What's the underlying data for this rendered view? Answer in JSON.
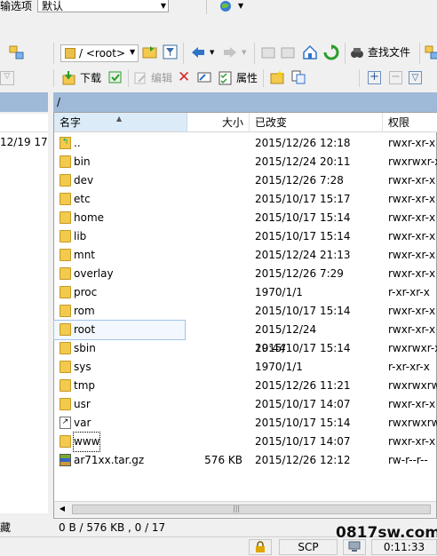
{
  "top": {
    "transfer_label": "传输选项",
    "transfer_value": "默认"
  },
  "toolbar": {
    "path_value": "/ <root>",
    "find_files": "查找文件"
  },
  "toolbar2": {
    "download": "下载",
    "edit": "编辑",
    "properties": "属性"
  },
  "left_panel": {
    "row_text": "12/19  17"
  },
  "path_bar": "/",
  "columns": {
    "name": "名字",
    "size": "大小",
    "date": "已改变",
    "perm": "权限"
  },
  "rows": [
    {
      "name": "..",
      "size": "",
      "date": "2015/12/26 12:18",
      "perm": "rwxr-xr-x",
      "icon": "parent-dir-icon"
    },
    {
      "name": "bin",
      "size": "",
      "date": "2015/12/24 20:11",
      "perm": "rwxrwxr-x",
      "icon": "folder-icon"
    },
    {
      "name": "dev",
      "size": "",
      "date": "2015/12/26 7:28",
      "perm": "rwxr-xr-x",
      "icon": "folder-icon"
    },
    {
      "name": "etc",
      "size": "",
      "date": "2015/10/17 15:17",
      "perm": "rwxr-xr-x",
      "icon": "folder-icon"
    },
    {
      "name": "home",
      "size": "",
      "date": "2015/10/17 15:14",
      "perm": "rwxr-xr-x",
      "icon": "folder-icon"
    },
    {
      "name": "lib",
      "size": "",
      "date": "2015/10/17 15:14",
      "perm": "rwxr-xr-x",
      "icon": "folder-icon"
    },
    {
      "name": "mnt",
      "size": "",
      "date": "2015/12/24 21:13",
      "perm": "rwxr-xr-x",
      "icon": "folder-icon"
    },
    {
      "name": "overlay",
      "size": "",
      "date": "2015/12/26 7:29",
      "perm": "rwxr-xr-x",
      "icon": "folder-icon"
    },
    {
      "name": "proc",
      "size": "",
      "date": "1970/1/1",
      "perm": "r-xr-xr-x",
      "icon": "folder-icon"
    },
    {
      "name": "rom",
      "size": "",
      "date": "2015/10/17 15:14",
      "perm": "rwxr-xr-x",
      "icon": "folder-icon"
    },
    {
      "name": "root",
      "size": "",
      "date": "2015/12/24 19:44",
      "perm": "rwxr-xr-x",
      "icon": "folder-icon"
    },
    {
      "name": "sbin",
      "size": "",
      "date": "2015/10/17 15:14",
      "perm": "rwxrwxr-x",
      "icon": "folder-icon"
    },
    {
      "name": "sys",
      "size": "",
      "date": "1970/1/1",
      "perm": "r-xr-xr-x",
      "icon": "folder-icon"
    },
    {
      "name": "tmp",
      "size": "",
      "date": "2015/12/26 11:21",
      "perm": "rwxrwxrw",
      "icon": "folder-icon"
    },
    {
      "name": "usr",
      "size": "",
      "date": "2015/10/17 14:07",
      "perm": "rwxr-xr-x",
      "icon": "folder-icon"
    },
    {
      "name": "var",
      "size": "",
      "date": "2015/10/17 15:14",
      "perm": "rwxrwxrw",
      "icon": "symlink-icon"
    },
    {
      "name": "www",
      "size": "",
      "date": "2015/10/17 14:07",
      "perm": "rwxr-xr-x",
      "icon": "folder-icon"
    },
    {
      "name": "ar71xx.tar.gz",
      "size": "576 KB",
      "date": "2015/12/26 12:12",
      "perm": "rw-r--r--",
      "icon": "archive-icon"
    }
  ],
  "status": {
    "left_text": "隐藏",
    "summary": "0 B / 576 KB ,  0 / 17",
    "protocol": "SCP",
    "time": "0:11:33"
  },
  "watermark": "0817sw.com"
}
